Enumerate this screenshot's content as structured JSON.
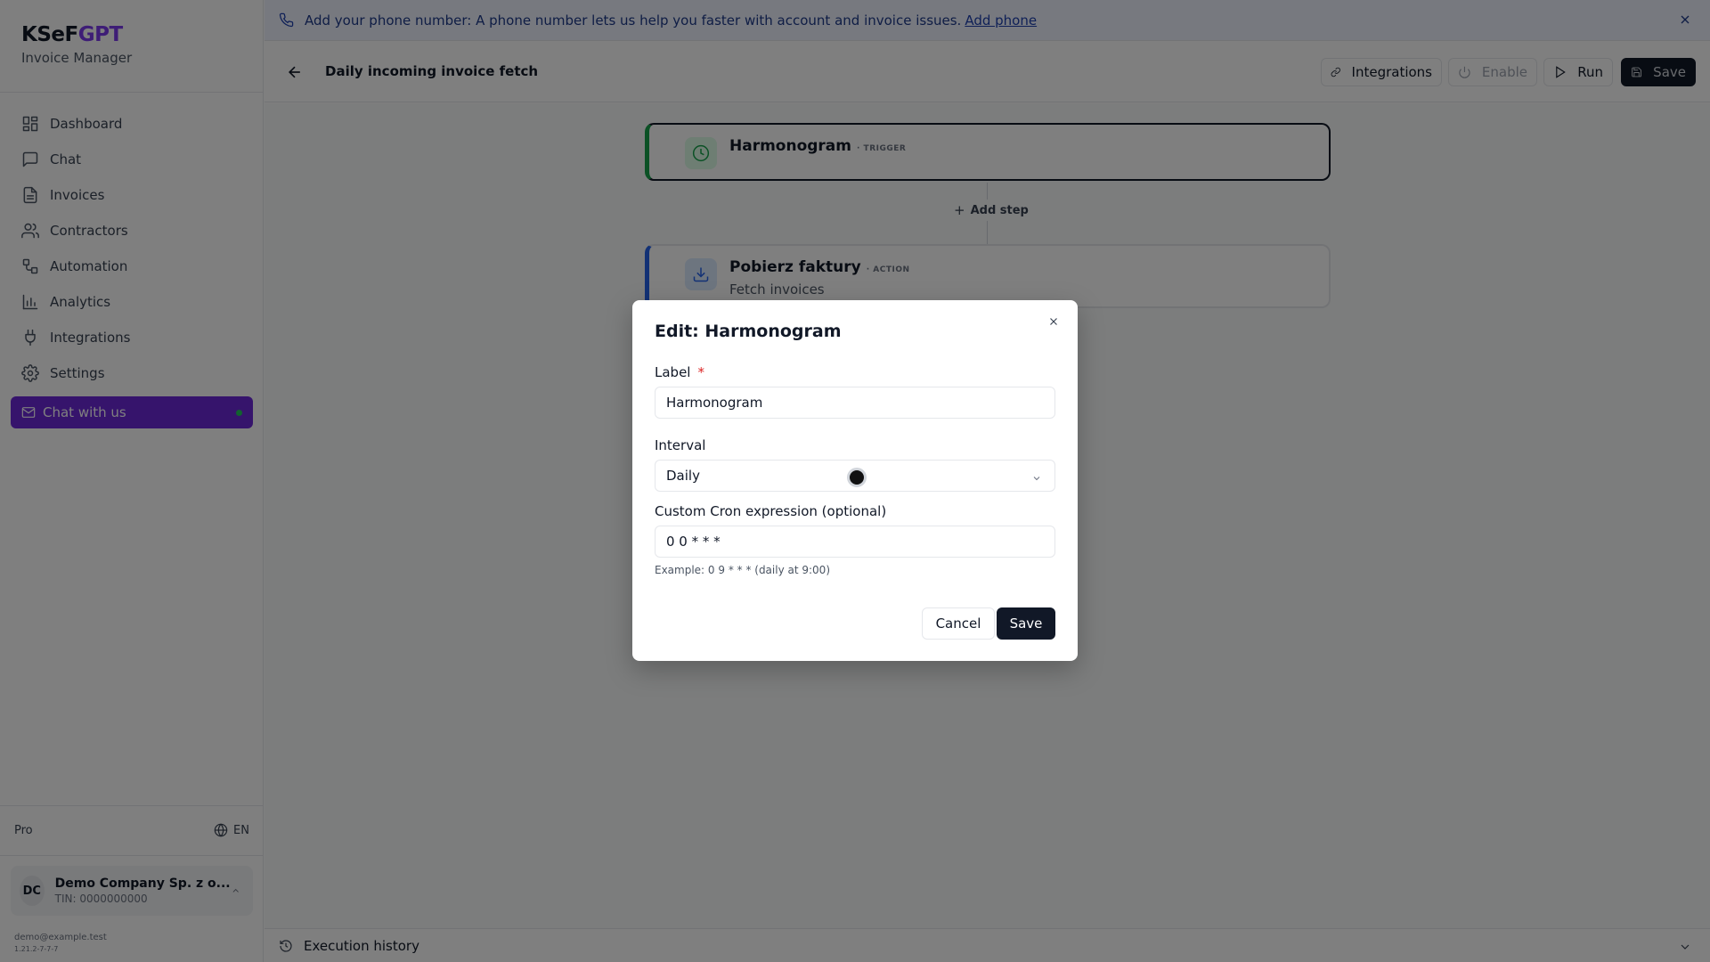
{
  "brand": {
    "name_prefix": "KSeF",
    "name_suffix": "GPT",
    "subtitle": "Invoice Manager"
  },
  "sidebar": {
    "items": [
      {
        "label": "Dashboard",
        "icon": "dashboard-icon"
      },
      {
        "label": "Chat",
        "icon": "chat-icon"
      },
      {
        "label": "Invoices",
        "icon": "invoice-icon"
      },
      {
        "label": "Contractors",
        "icon": "users-icon"
      },
      {
        "label": "Automation",
        "icon": "workflow-icon"
      },
      {
        "label": "Analytics",
        "icon": "bar-chart-icon"
      },
      {
        "label": "Integrations",
        "icon": "plug-icon"
      },
      {
        "label": "Settings",
        "icon": "gear-icon"
      }
    ],
    "chat_button": "Chat with us",
    "plan": "Pro",
    "language": "EN",
    "company": {
      "initials": "DC",
      "name": "Demo Company Sp. z o...",
      "tin": "TIN: 0000000000"
    },
    "email": "demo@example.test",
    "version": "1.21.2-7-7-7"
  },
  "banner": {
    "text": "Add your phone number: A phone number lets us help you faster with account and invoice issues.",
    "link": "Add phone"
  },
  "toolbar": {
    "title": "Daily incoming invoice fetch",
    "integrations": "Integrations",
    "enable": "Enable",
    "run": "Run",
    "save": "Save"
  },
  "workflow": {
    "trigger": {
      "title": "Harmonogram",
      "type": "· TRIGGER"
    },
    "add_step": "Add step",
    "action": {
      "title": "Pobierz faktury",
      "type": "· ACTION",
      "subtitle": "Fetch invoices"
    }
  },
  "execution_history": "Execution history",
  "modal": {
    "title": "Edit: Harmonogram",
    "label_field": {
      "label": "Label",
      "required": "*",
      "value": "Harmonogram"
    },
    "interval_field": {
      "label": "Interval",
      "value": "Daily"
    },
    "cron_field": {
      "label": "Custom Cron expression (optional)",
      "value": "0 0 * * *"
    },
    "hint": "Example: 0 9 * * * (daily at 9:00)",
    "cancel": "Cancel",
    "save": "Save"
  },
  "colors": {
    "accent": "#6d28d9",
    "trigger": "#16a34a",
    "action": "#2563eb",
    "banner_bg": "#eef2ff"
  }
}
